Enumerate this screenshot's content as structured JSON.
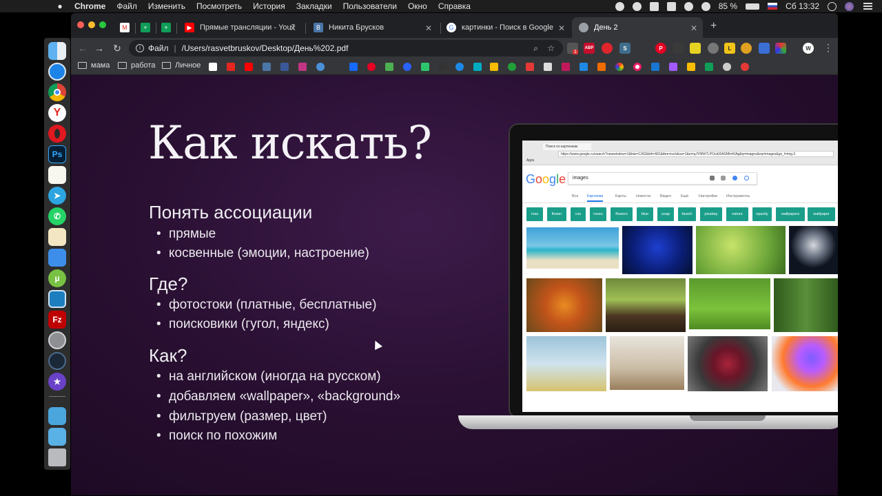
{
  "menubar": {
    "app": "Chrome",
    "items": [
      "Файл",
      "Изменить",
      "Посмотреть",
      "История",
      "Закладки",
      "Пользователи",
      "Окно",
      "Справка"
    ],
    "battery": "85 %",
    "clock": "Сб 13:32"
  },
  "browser": {
    "tabs": [
      {
        "title": "Прямые трансляции - YouTub",
        "icon": "youtube-icon",
        "color": "#ff0000"
      },
      {
        "title": "Никита Брусков",
        "icon": "vk-icon",
        "color": "#4a76a8"
      },
      {
        "title": "картинки - Поиск в Google",
        "icon": "google-icon",
        "color": "#ffffff"
      },
      {
        "title": "День 2",
        "icon": "globe-icon",
        "color": "#9aa0a6"
      }
    ],
    "address": {
      "prefix": "Файл",
      "url": "/Users/rasvetbruskov/Desktop/День%202.pdf"
    },
    "bookmarks": [
      "мама",
      "работа",
      "Личное"
    ],
    "ext_badge": "1",
    "ext_abp": "ABP",
    "ext_avatar": "W"
  },
  "slide": {
    "title": "Как искать?",
    "sections": [
      {
        "heading": "Понять ассоциации",
        "bullets": [
          "прямые",
          "косвенные (эмоции, настроение)"
        ]
      },
      {
        "heading": "Где?",
        "bullets": [
          "фотостоки (платные, бесплатные)",
          "поисковики (гугол, яндекс)"
        ]
      },
      {
        "heading": "Как?",
        "bullets": [
          "на английском (иногда на русском)",
          "добавляем «wallpaper», «background»",
          "фильтруем (размер, цвет)",
          "поиск по похожим"
        ]
      }
    ]
  },
  "laptop_screen": {
    "tab_title": "Поиск по картинкам",
    "url": "https://www.google.ru/search?newwindow=1&biw=1242&bih=681&tbm=isch&sa=1&ei=qJYMW7LPOoiU6ASMhrKIAg&q=images&oq=images&gs_l=img.3",
    "apps": "Apps",
    "logo": "Google",
    "query": "images",
    "tabs": [
      "Все",
      "Картинки",
      "Карты",
      "Новости",
      "Видео",
      "Ещё",
      "Настройки",
      "Инструменты"
    ],
    "chips": [
      "rose",
      "flower",
      "css",
      "roses",
      "flowers",
      "blue",
      "soap",
      "beach",
      "pixabay",
      "nature",
      "opacity",
      "wallpapers",
      "wallpaper"
    ]
  }
}
